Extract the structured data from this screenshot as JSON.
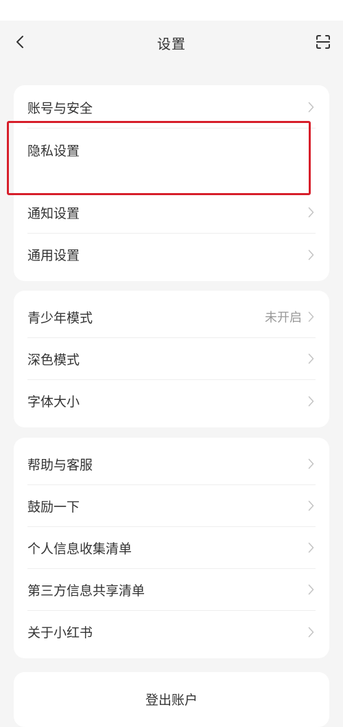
{
  "header": {
    "title": "设置"
  },
  "groups": {
    "account": {
      "items": [
        {
          "label": "账号与安全"
        },
        {
          "label": "隐私设置"
        },
        {
          "label": "通知设置"
        },
        {
          "label": "通用设置"
        }
      ]
    },
    "display": {
      "items": [
        {
          "label": "青少年模式",
          "value": "未开启"
        },
        {
          "label": "深色模式"
        },
        {
          "label": "字体大小"
        }
      ]
    },
    "support": {
      "items": [
        {
          "label": "帮助与客服"
        },
        {
          "label": "鼓励一下"
        },
        {
          "label": "个人信息收集清单"
        },
        {
          "label": "第三方信息共享清单"
        },
        {
          "label": "关于小红书"
        }
      ]
    }
  },
  "logout": {
    "label": "登出账户"
  },
  "icons": {
    "back": "chevron-left-icon",
    "scan": "scan-icon",
    "row_arrow": "chevron-right-icon"
  },
  "colors": {
    "highlight": "#d71e2a",
    "background": "#f5f5f5",
    "card": "#ffffff",
    "secondary_text": "#999999"
  }
}
